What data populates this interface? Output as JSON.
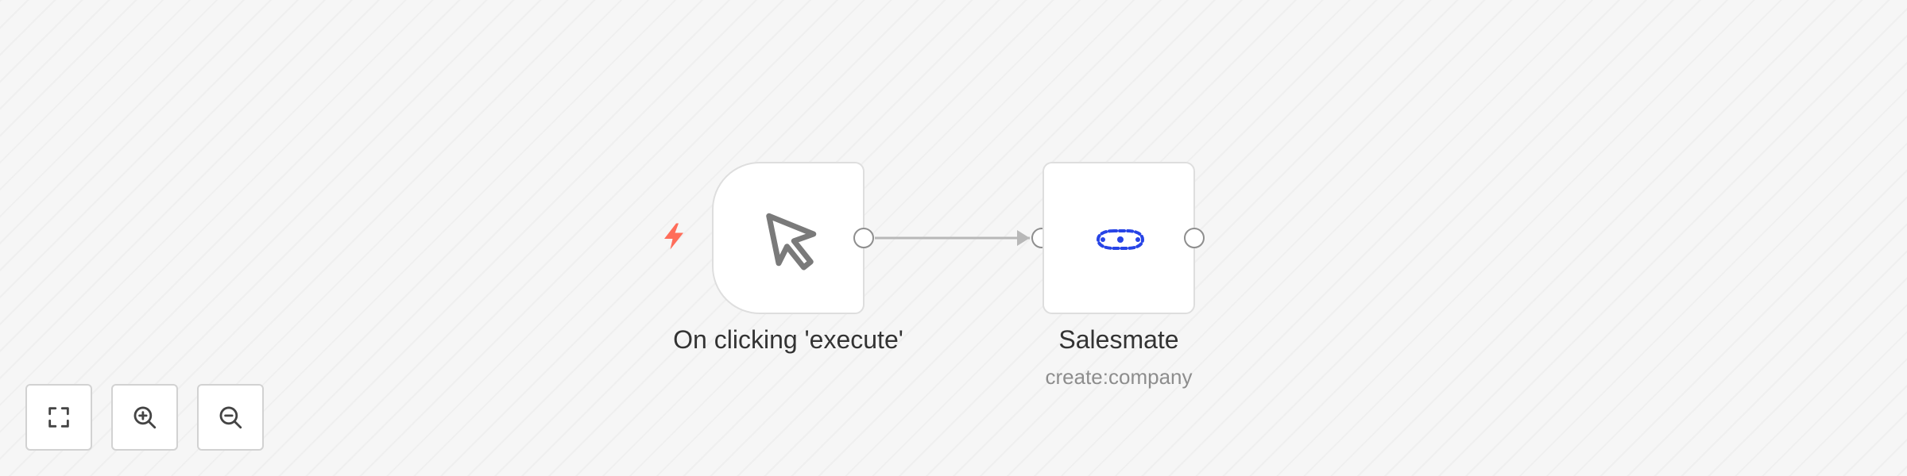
{
  "workflow": {
    "nodes": [
      {
        "title": "On clicking 'execute'",
        "subtitle": "",
        "icon": "cursor-arrow-icon",
        "type": "trigger",
        "trigger_indicator_icon": "lightning-bolt-icon"
      },
      {
        "title": "Salesmate",
        "subtitle": "create:company",
        "icon": "salesmate-logo-icon"
      }
    ],
    "connections": [
      {
        "from": "On clicking 'execute'",
        "to": "Salesmate"
      }
    ]
  },
  "controls": {
    "buttons": [
      {
        "icon": "fit-view-icon",
        "action": "zoom-to-fit"
      },
      {
        "icon": "zoom-in-icon",
        "action": "zoom-in"
      },
      {
        "icon": "zoom-out-icon",
        "action": "zoom-out"
      }
    ]
  },
  "colors": {
    "canvas_background": "#f6f6f6",
    "node_border": "#dedede",
    "handle_border": "#8e8e8e",
    "connection": "#b8b8b8",
    "trigger_bolt": "#ff6d5a",
    "salesmate_logo": "#2744e6",
    "cursor_icon": "#7a7a7a",
    "title_text": "#333333",
    "subtitle_text": "#8d8d8d"
  }
}
